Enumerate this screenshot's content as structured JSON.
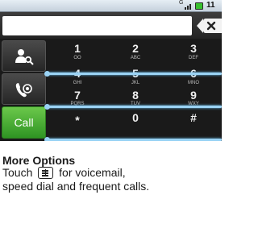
{
  "status_bar": {
    "network_label": "G",
    "clock": "11"
  },
  "dial": {
    "number_value": "",
    "backspace_icon": "backspace-x-icon"
  },
  "side_buttons": {
    "contacts_icon": "contact-search-icon",
    "voicemail_icon": "voicemail-icon",
    "call_label": "Call"
  },
  "keypad": {
    "keys": [
      {
        "digit": "1",
        "letters": "OO"
      },
      {
        "digit": "2",
        "letters": "ABC"
      },
      {
        "digit": "3",
        "letters": "DEF"
      },
      {
        "digit": "4",
        "letters": "GHI"
      },
      {
        "digit": "5",
        "letters": "JKL"
      },
      {
        "digit": "6",
        "letters": "MNO"
      },
      {
        "digit": "7",
        "letters": "PQRS"
      },
      {
        "digit": "8",
        "letters": "TUV"
      },
      {
        "digit": "9",
        "letters": "WXY"
      },
      {
        "digit": "*",
        "letters": ""
      },
      {
        "digit": "0",
        "letters": "+"
      },
      {
        "digit": "#",
        "letters": ""
      }
    ]
  },
  "caption": {
    "heading": "More Options",
    "touch_word": "Touch",
    "line1_rest": "for voicemail,",
    "line2": "speed dial and frequent calls.",
    "icon": "menu-key-icon"
  },
  "colors": {
    "call_green": "#3aa52b",
    "callout_blue": "#9ad3f5",
    "status_bar": "#d6e0ea"
  }
}
